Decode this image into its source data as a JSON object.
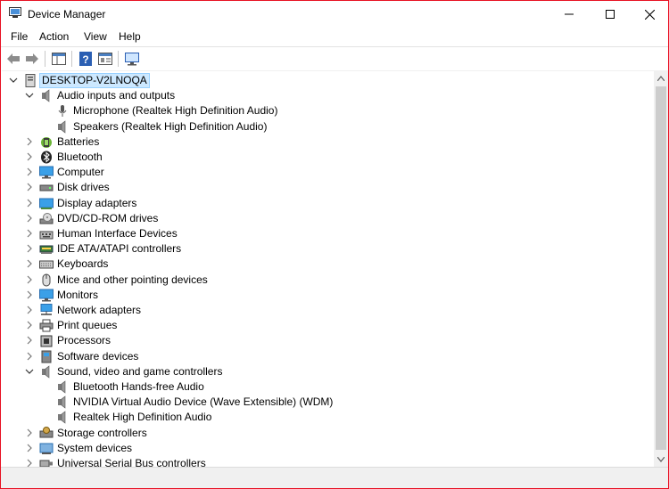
{
  "window": {
    "title": "Device Manager"
  },
  "menu": [
    "File",
    "Action",
    "View",
    "Help"
  ],
  "tree": {
    "root": "DESKTOP-V2LNOQA",
    "items": [
      {
        "label": "Audio inputs and outputs",
        "level": 1,
        "expanded": true,
        "icon": "speaker-icon"
      },
      {
        "label": "Microphone (Realtek High Definition Audio)",
        "level": 2,
        "icon": "microphone-icon"
      },
      {
        "label": "Speakers (Realtek High Definition Audio)",
        "level": 2,
        "icon": "speaker-icon"
      },
      {
        "label": "Batteries",
        "level": 1,
        "expanded": false,
        "icon": "battery-icon"
      },
      {
        "label": "Bluetooth",
        "level": 1,
        "expanded": false,
        "icon": "bluetooth-icon"
      },
      {
        "label": "Computer",
        "level": 1,
        "expanded": false,
        "icon": "computer-icon"
      },
      {
        "label": "Disk drives",
        "level": 1,
        "expanded": false,
        "icon": "disk-drive-icon"
      },
      {
        "label": "Display adapters",
        "level": 1,
        "expanded": false,
        "icon": "display-adapter-icon"
      },
      {
        "label": "DVD/CD-ROM drives",
        "level": 1,
        "expanded": false,
        "icon": "dvd-drive-icon"
      },
      {
        "label": "Human Interface Devices",
        "level": 1,
        "expanded": false,
        "icon": "hid-icon"
      },
      {
        "label": "IDE ATA/ATAPI controllers",
        "level": 1,
        "expanded": false,
        "icon": "ide-controller-icon"
      },
      {
        "label": "Keyboards",
        "level": 1,
        "expanded": false,
        "icon": "keyboard-icon"
      },
      {
        "label": "Mice and other pointing devices",
        "level": 1,
        "expanded": false,
        "icon": "mouse-icon"
      },
      {
        "label": "Monitors",
        "level": 1,
        "expanded": false,
        "icon": "monitor-icon"
      },
      {
        "label": "Network adapters",
        "level": 1,
        "expanded": false,
        "icon": "network-adapter-icon"
      },
      {
        "label": "Print queues",
        "level": 1,
        "expanded": false,
        "icon": "printer-icon"
      },
      {
        "label": "Processors",
        "level": 1,
        "expanded": false,
        "icon": "processor-icon"
      },
      {
        "label": "Software devices",
        "level": 1,
        "expanded": false,
        "icon": "software-device-icon"
      },
      {
        "label": "Sound, video and game controllers",
        "level": 1,
        "expanded": true,
        "icon": "speaker-icon"
      },
      {
        "label": "Bluetooth Hands-free Audio",
        "level": 2,
        "icon": "speaker-icon"
      },
      {
        "label": "NVIDIA Virtual Audio Device (Wave Extensible) (WDM)",
        "level": 2,
        "icon": "speaker-icon"
      },
      {
        "label": "Realtek High Definition Audio",
        "level": 2,
        "icon": "speaker-icon"
      },
      {
        "label": "Storage controllers",
        "level": 1,
        "expanded": false,
        "icon": "storage-controller-icon"
      },
      {
        "label": "System devices",
        "level": 1,
        "expanded": false,
        "icon": "system-device-icon"
      },
      {
        "label": "Universal Serial Bus controllers",
        "level": 1,
        "expanded": false,
        "icon": "usb-icon"
      }
    ]
  },
  "colors": {
    "selection": "#cce8ff",
    "selection_border": "#99d1ff",
    "window_border": "#e81123"
  }
}
